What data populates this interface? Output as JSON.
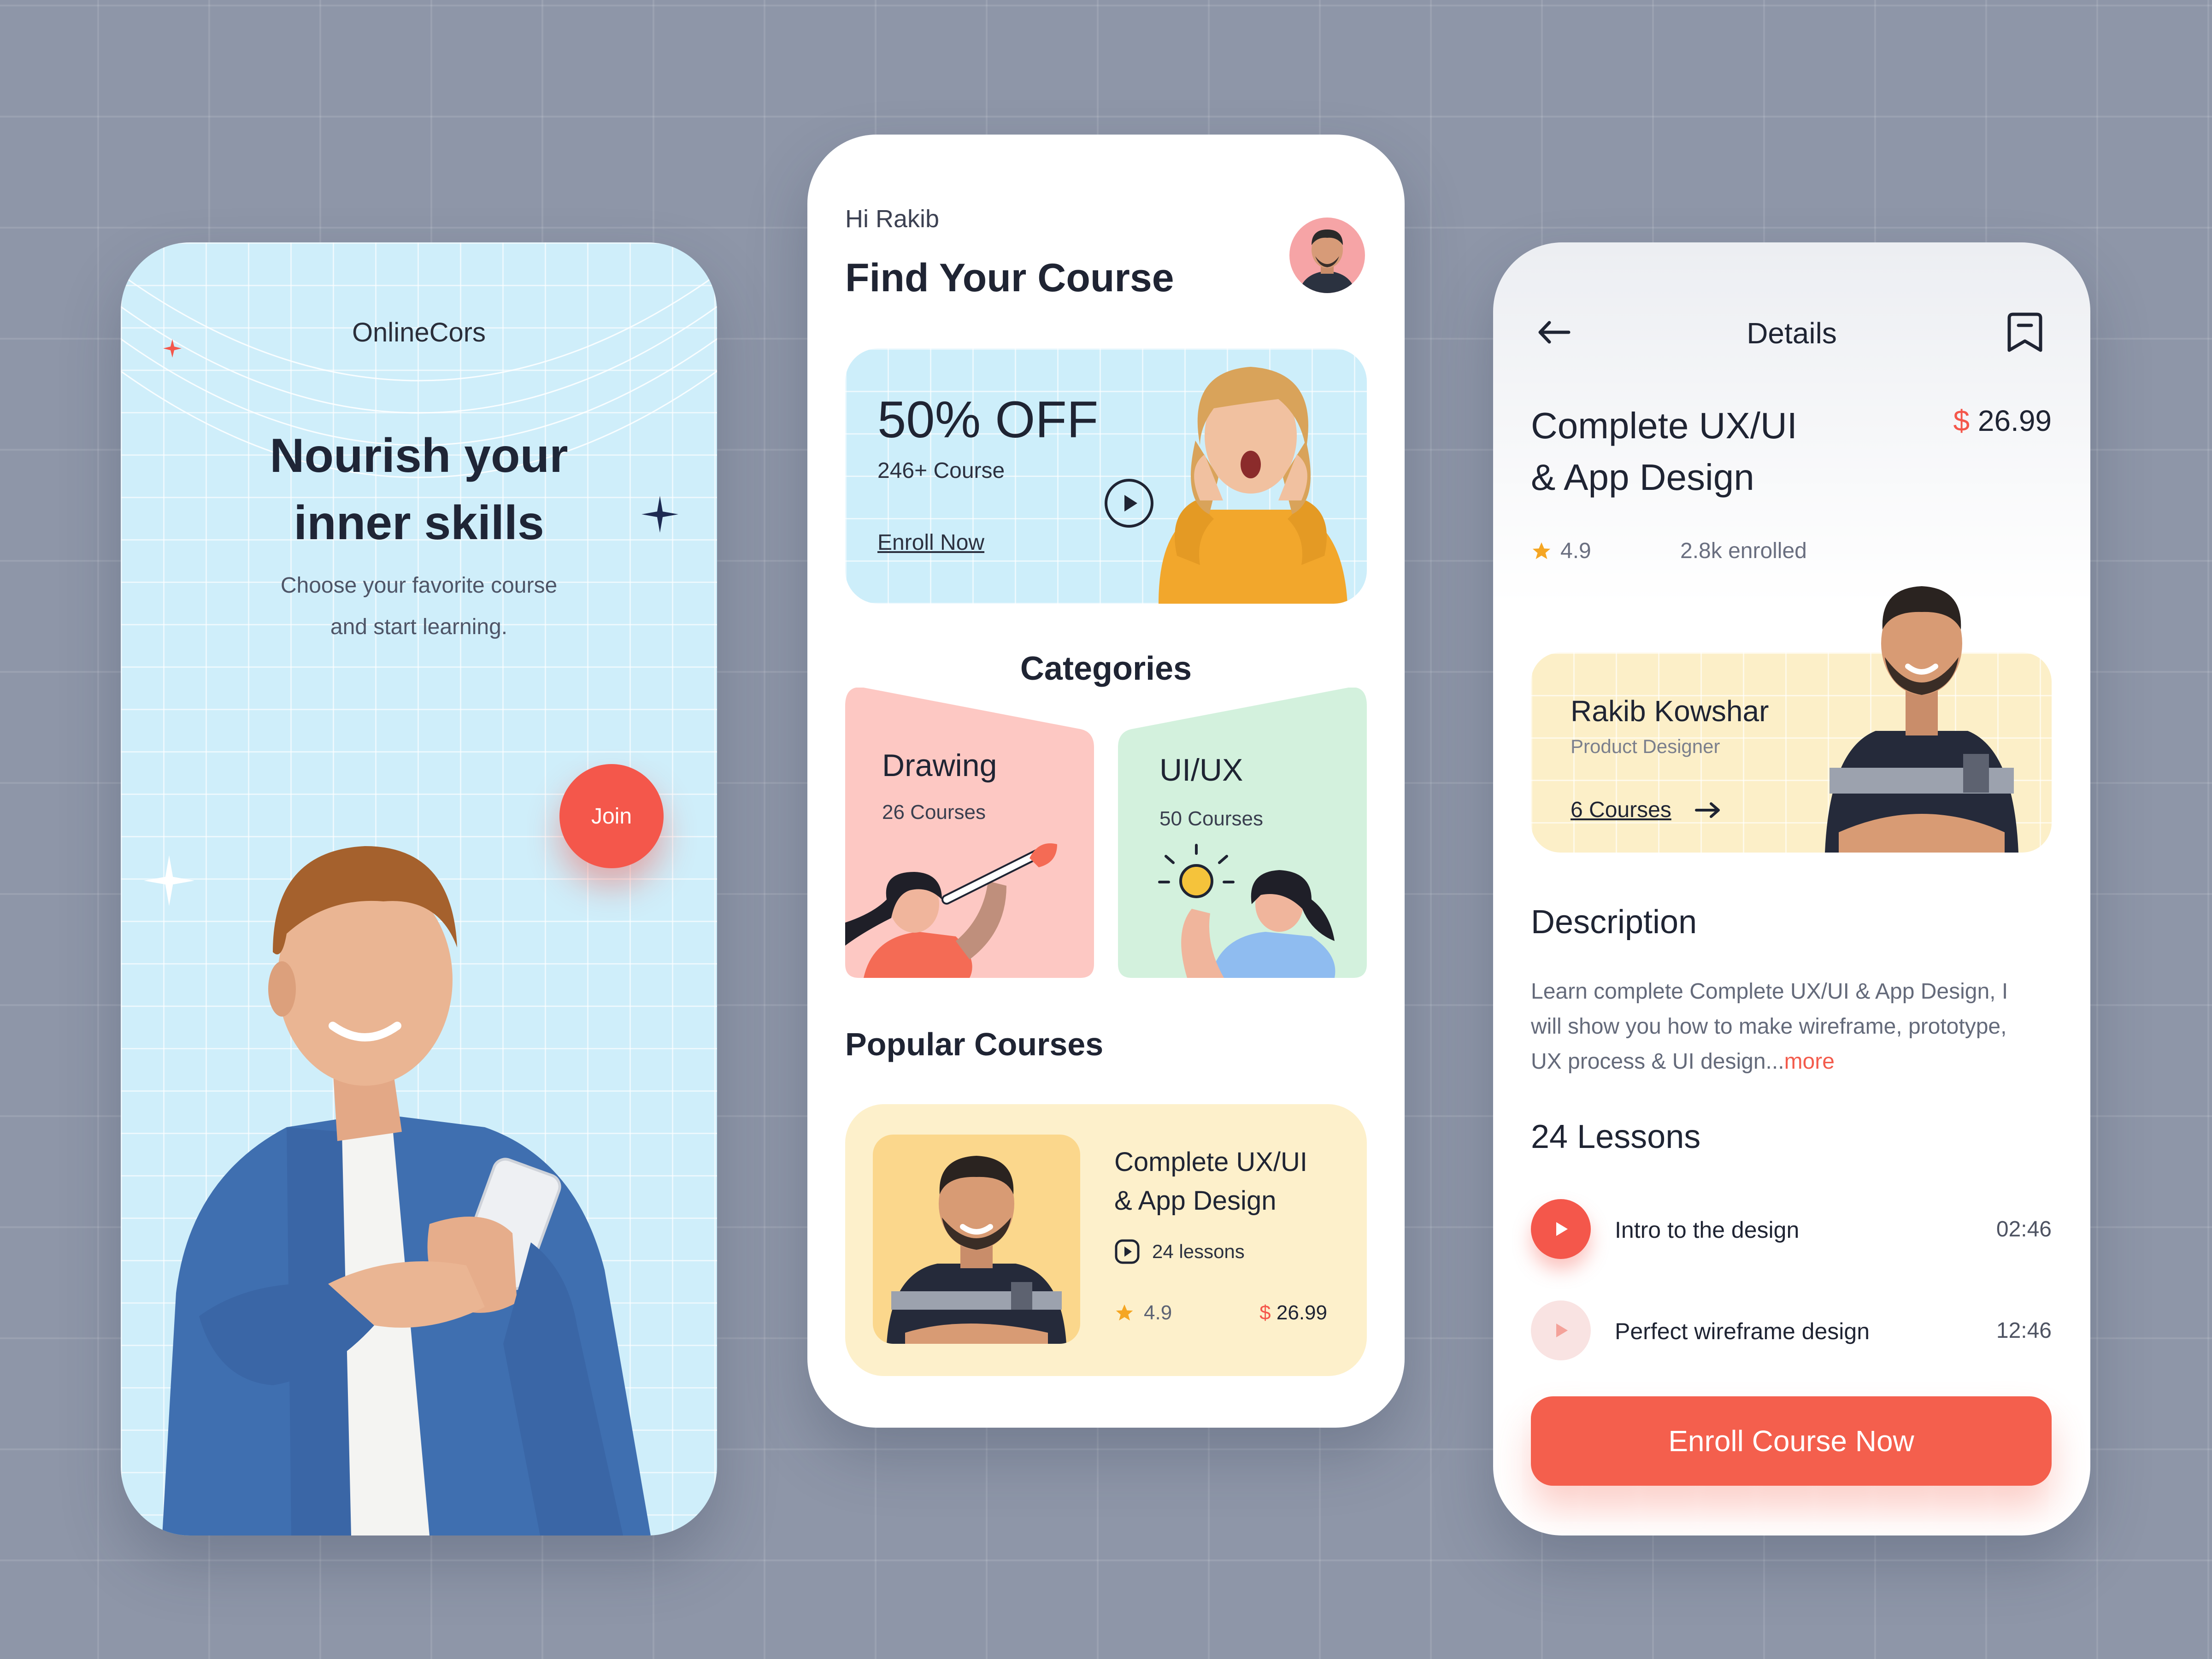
{
  "onboarding": {
    "brand": "OnlineCors",
    "headline_line1": "Nourish your",
    "headline_line2": "inner skills",
    "subtitle_line1": "Choose your favorite course",
    "subtitle_line2": "and start learning.",
    "join_label": "Join"
  },
  "home": {
    "greeting": "Hi Rakib",
    "title": "Find Your Course",
    "promo": {
      "discount": "50% OFF",
      "course_count": "246+ Course",
      "enroll_label": "Enroll Now"
    },
    "categories_title": "Categories",
    "categories": [
      {
        "name": "Drawing",
        "count": "26 Courses",
        "color": "#fdc8c3"
      },
      {
        "name": "UI/UX",
        "count": "50 Courses",
        "color": "#d3f1dd"
      }
    ],
    "popular_title": "Popular Courses",
    "popular_course": {
      "title_line1": "Complete UX/UI",
      "title_line2": "& App Design",
      "lessons": "24 lessons",
      "rating": "4.9",
      "price_symbol": "$",
      "price": "26.99"
    }
  },
  "details": {
    "header_title": "Details",
    "title_line1": "Complete UX/UI",
    "title_line2": "& App Design",
    "price_symbol": "$",
    "price": "26.99",
    "rating": "4.9",
    "enrolled": "2.8k enrolled",
    "instructor": {
      "name": "Rakib Kowshar",
      "role": "Product Designer",
      "courses_label": "6 Courses"
    },
    "description_title": "Description",
    "description_line1": "Learn complete Complete UX/UI & App Design, I",
    "description_line2": "will show you how to make wireframe, prototype,",
    "description_line3": "UX process & UI design...",
    "more_label": "more",
    "lessons_title": "24 Lessons",
    "lessons": [
      {
        "name": "Intro to the design",
        "time": "02:46"
      },
      {
        "name": "Perfect wireframe design",
        "time": "12:46"
      }
    ],
    "enroll_button": "Enroll Course Now"
  },
  "colors": {
    "accent": "#f4574b",
    "star": "#f5a623",
    "onboarding_bg": "#cfeefa",
    "promo_bg": "#cdeefa",
    "course_card_bg": "#fdf0cb",
    "instructor_bg": "#fcefc8"
  },
  "icons": [
    "sparkle-icon",
    "star-icon",
    "play-icon",
    "back-arrow-icon",
    "bookmark-icon",
    "arrow-right-icon",
    "lesson-play-icon"
  ]
}
